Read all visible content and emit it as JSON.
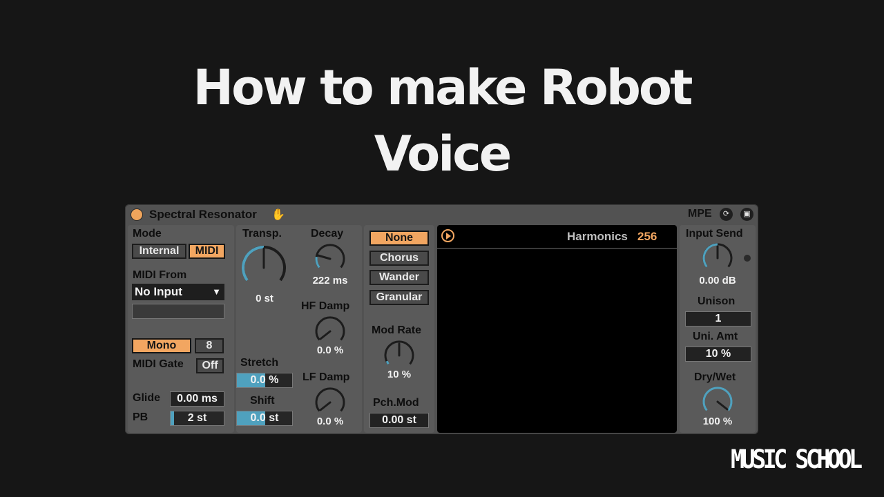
{
  "headline": {
    "line1": "How to make Robot",
    "line2": "Voice"
  },
  "device": {
    "title": "Spectral Resonator",
    "mpe_label": "MPE",
    "accent_color": "#f2a661",
    "knob_arc_color": "#4fa1be"
  },
  "midi": {
    "mode_label": "Mode",
    "mode_options": [
      "Internal",
      "MIDI"
    ],
    "mode_selected": "MIDI",
    "midi_from_label": "MIDI From",
    "midi_from_value": "No Input",
    "voice_mode": "Mono",
    "voices": "8",
    "midi_gate_label": "MIDI Gate",
    "midi_gate_value": "Off",
    "glide_label": "Glide",
    "glide_value": "0.00 ms",
    "pb_label": "PB",
    "pb_value": "2 st"
  },
  "pitch": {
    "transp_label": "Transp.",
    "transp_value": "0 st",
    "stretch_label": "Stretch",
    "stretch_value": "0.0 %",
    "shift_label": "Shift",
    "shift_value": "0.0 st",
    "decay_label": "Decay",
    "decay_value": "222 ms",
    "hf_damp_label": "HF Damp",
    "hf_damp_value": "0.0 %",
    "lf_damp_label": "LF Damp",
    "lf_damp_value": "0.0 %"
  },
  "modulation": {
    "types": [
      "None",
      "Chorus",
      "Wander",
      "Granular"
    ],
    "selected": "None",
    "mod_rate_label": "Mod Rate",
    "mod_rate_value": "10 %",
    "pch_mod_label": "Pch.Mod",
    "pch_mod_value": "0.00 st"
  },
  "display": {
    "harmonics_label": "Harmonics",
    "harmonics_value": "256"
  },
  "output": {
    "input_send_label": "Input Send",
    "input_send_value": "0.00 dB",
    "unison_label": "Unison",
    "unison_value": "1",
    "uni_amt_label": "Uni. Amt",
    "uni_amt_value": "10 %",
    "dry_wet_label": "Dry/Wet",
    "dry_wet_value": "100 %"
  },
  "logo_text": "MUSIC SCHOOL"
}
